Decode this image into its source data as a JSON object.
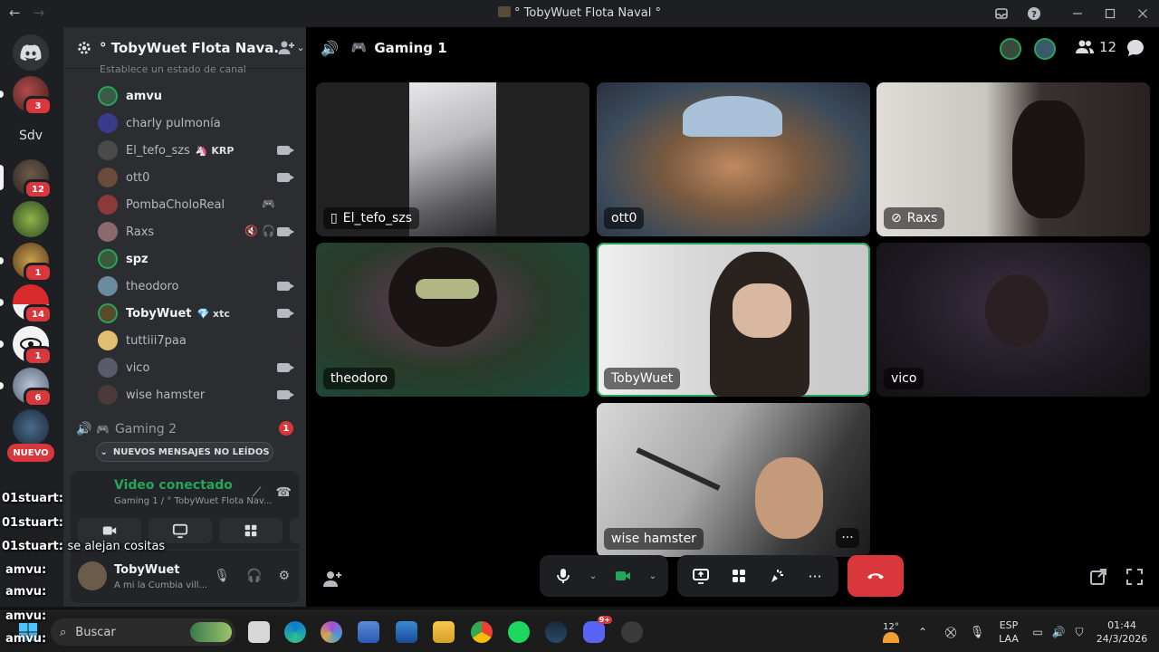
{
  "titlebar": {
    "back": "←",
    "forward": "→",
    "title": "° TobyWuet Flota Naval °"
  },
  "rail": {
    "badges": [
      "3",
      "12",
      "1",
      "14",
      "1",
      "6"
    ],
    "home_label": "Sdv",
    "new_label": "NUEVO"
  },
  "sidebar": {
    "guild_name": "° TobyWuet Flota Nava...",
    "status_line": "Establece un estado de canal",
    "members": [
      {
        "name": "amvu",
        "me": true,
        "tag": "",
        "cam": false
      },
      {
        "name": "charly pulmonía",
        "me": false,
        "tag": "",
        "cam": false
      },
      {
        "name": "El_tefo_szs",
        "me": false,
        "tag": "🦄 KRP",
        "cam": true
      },
      {
        "name": "ott0",
        "me": false,
        "tag": "",
        "cam": true
      },
      {
        "name": "PombaCholoReal",
        "me": false,
        "tag": "",
        "cam": false,
        "extra": "🎮"
      },
      {
        "name": "Raxs",
        "me": false,
        "tag": "",
        "cam": true,
        "extra": "🔇 🎧"
      },
      {
        "name": "spz",
        "me": true,
        "tag": "",
        "cam": false
      },
      {
        "name": "theodoro",
        "me": false,
        "tag": "",
        "cam": true
      },
      {
        "name": "TobyWuet",
        "me": true,
        "tag": "💎 xtc",
        "cam": true
      },
      {
        "name": "tuttiii7paa",
        "me": false,
        "tag": "",
        "cam": false
      },
      {
        "name": "vico",
        "me": false,
        "tag": "",
        "cam": true
      },
      {
        "name": "wise hamster",
        "me": false,
        "tag": "",
        "cam": true
      }
    ],
    "voice_channel_2": "Gaming 2",
    "voice_channel_2_count": "1",
    "new_messages": "NUEVOS MENSAJES NO LEÍDOS",
    "voice_panel": {
      "status": "Video conectado",
      "subtitle": "Gaming 1 / ° TobyWuet Flota Nav..."
    },
    "user_panel": {
      "name": "TobyWuet",
      "status": "A mi la Cumbia vill..."
    }
  },
  "overlay_chat": [
    {
      "user": "01stuart:",
      "text": ""
    },
    {
      "user": "01stuart:",
      "text": ""
    },
    {
      "user": "01stuart:",
      "text": "se alejan cositas"
    },
    {
      "user": "amvu:",
      "text": ""
    },
    {
      "user": "amvu:",
      "text": ""
    },
    {
      "user": "amvu:",
      "text": ""
    },
    {
      "user": "amvu:",
      "text": ""
    }
  ],
  "main": {
    "channel_name": "Gaming 1",
    "participants_count": "12",
    "tiles": [
      {
        "name": "El_tefo_szs",
        "icon": "phone-icon"
      },
      {
        "name": "ott0"
      },
      {
        "name": "Raxs",
        "icon": "muted-cam-icon"
      },
      {
        "name": "theodoro"
      },
      {
        "name": "TobyWuet",
        "speaking": true
      },
      {
        "name": "vico"
      },
      {
        "name": "wise hamster",
        "more": "···"
      }
    ]
  },
  "taskbar": {
    "search_placeholder": "Buscar",
    "weather": "12°",
    "lang_top": "ESP",
    "lang_bottom": "LAA",
    "time": "01:44",
    "date": "24/3/2026",
    "discord_badge": "9+"
  },
  "colors": {
    "accent_green": "#23a55a",
    "danger_red": "#da373c",
    "sidebar_bg": "#2b2d31",
    "rail_bg": "#1e1f22"
  }
}
